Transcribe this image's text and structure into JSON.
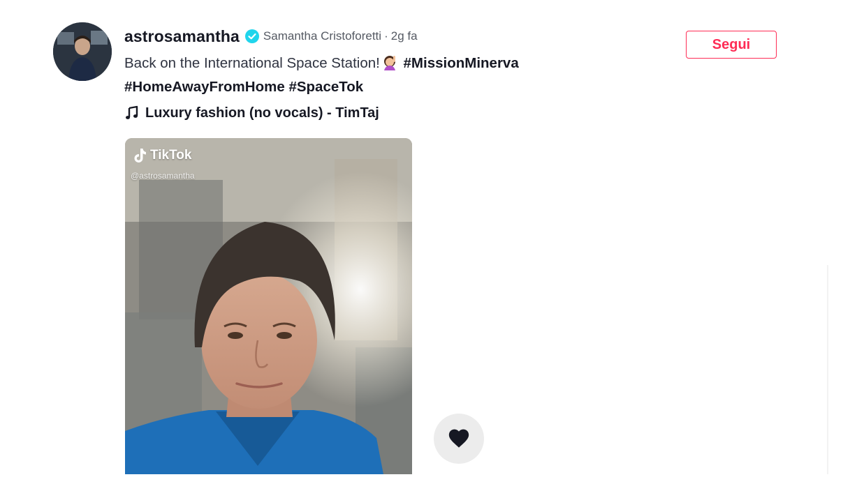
{
  "post": {
    "username": "astrosamantha",
    "nickname": "Samantha Cristoforetti",
    "separator": "·",
    "date": "2g fa",
    "caption_text": "Back on the International Space Station!",
    "caption_emoji": "woman-gesturing-emoji",
    "hashtags": [
      "#MissionMinerva",
      "#HomeAwayFromHome",
      "#SpaceTok"
    ],
    "music": "Luxury fashion (no vocals) - TimTaj",
    "follow_label": "Segui"
  },
  "video": {
    "watermark_brand": "TikTok",
    "watermark_handle": "@astrosamantha"
  },
  "icons": {
    "verified": "verified-badge-icon",
    "music": "music-note-icon",
    "like": "heart-icon",
    "brand": "tiktok-logo-icon"
  },
  "colors": {
    "accent": "#fe2c55",
    "verified": "#20d5ec",
    "text_primary": "#161823",
    "text_secondary": "#555a63"
  }
}
